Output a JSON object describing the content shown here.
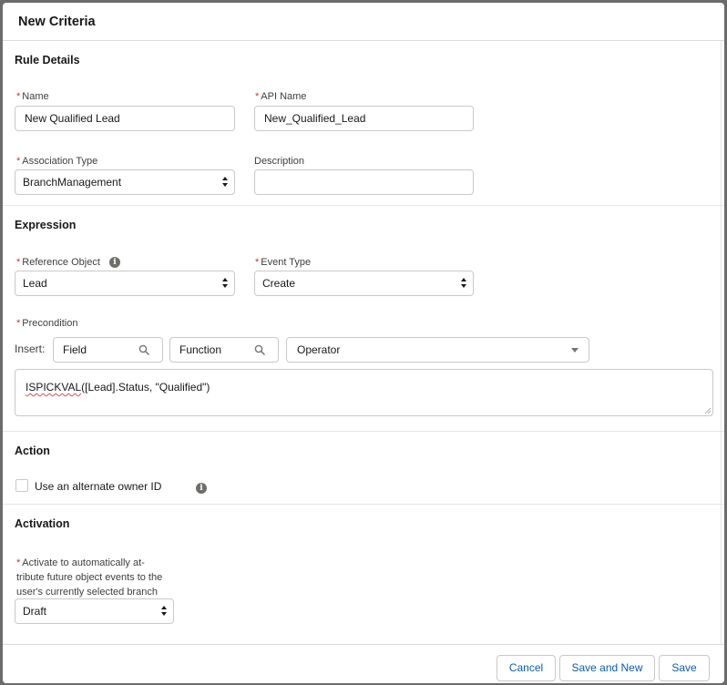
{
  "modal": {
    "title": "New Criteria"
  },
  "rule_details": {
    "title": "Rule Details",
    "name": {
      "label": "Name",
      "value": "New Qualified Lead"
    },
    "api_name": {
      "label": "API Name",
      "value": "New_Qualified_Lead"
    },
    "association_type": {
      "label": "Association Type",
      "value": "BranchManagement"
    },
    "description": {
      "label": "Description",
      "value": ""
    }
  },
  "expression": {
    "title": "Expression",
    "reference_object": {
      "label": "Reference Object",
      "value": "Lead"
    },
    "event_type": {
      "label": "Event Type",
      "value": "Create"
    },
    "precondition": {
      "label": "Precondition",
      "insert_label": "Insert:",
      "field": "Field",
      "function": "Function",
      "operator": "Operator",
      "formula_func": "ISPICKVAL",
      "formula_rest": "([Lead].Status, \"Qualified\")"
    }
  },
  "action": {
    "title": "Action",
    "alternate_owner_label": "Use an alternate owner ID",
    "alternate_owner_checked": false
  },
  "activation": {
    "title": "Activation",
    "label_line1": "Activate to automatically at-",
    "label_line2": "tribute future object events to the",
    "label_line3": "user's currently selected branch",
    "value": "Draft"
  },
  "footer": {
    "cancel": "Cancel",
    "save_and_new": "Save and New",
    "save": "Save"
  },
  "colors": {
    "required": "#c23934",
    "button_text": "#0b5cab",
    "info_icon": "#706e6b"
  },
  "icons": {
    "info": "info-icon",
    "search": "search-icon",
    "dropdown": "chevron-down-icon",
    "select": "up-down-chevron-icon"
  }
}
